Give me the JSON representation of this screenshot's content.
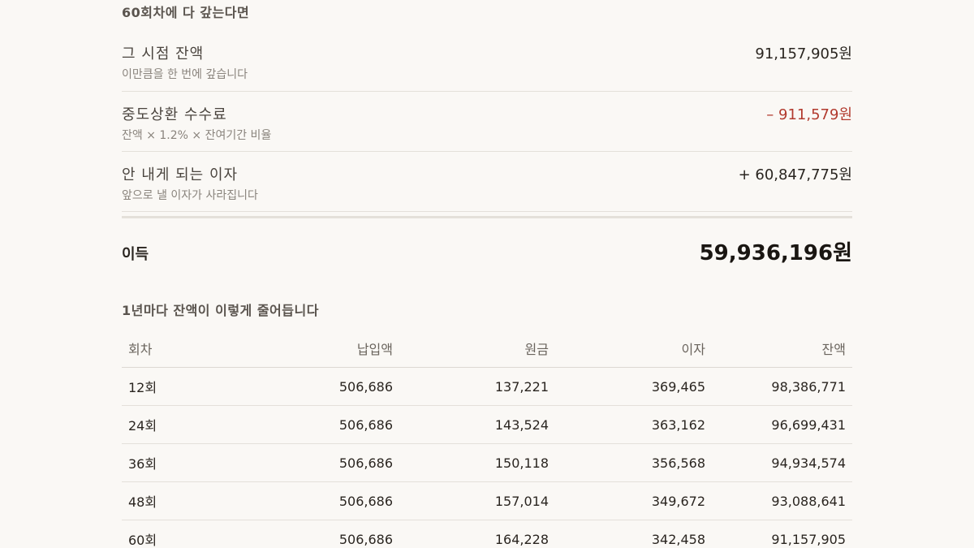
{
  "summary": {
    "title": "60회차에 다 갚는다면",
    "rows": [
      {
        "label": "그 시점 잔액",
        "sub": "이만큼을 한 번에 갚습니다",
        "amount": "91,157,905원"
      },
      {
        "label": "중도상환 수수료",
        "sub": "잔액 × 1.2% × 잔여기간 비율",
        "amount": "– 911,579원"
      },
      {
        "label": "안 내게 되는 이자",
        "sub": "앞으로 낼 이자가 사라집니다",
        "amount": "+ 60,847,775원"
      }
    ],
    "profit_label": "이득",
    "profit_amount": "59,936,196원"
  },
  "schedule": {
    "title": "1년마다 잔액이 이렇게 줄어듭니다",
    "headers": [
      "회차",
      "납입액",
      "원금",
      "이자",
      "잔액"
    ],
    "rows": [
      [
        "12회",
        "506,686",
        "137,221",
        "369,465",
        "98,386,771"
      ],
      [
        "24회",
        "506,686",
        "143,524",
        "363,162",
        "96,699,431"
      ],
      [
        "36회",
        "506,686",
        "150,118",
        "356,568",
        "94,934,574"
      ],
      [
        "48회",
        "506,686",
        "157,014",
        "349,672",
        "93,088,641"
      ],
      [
        "60회",
        "506,686",
        "164,228",
        "342,458",
        "91,157,905"
      ]
    ]
  },
  "colors": {
    "background": "#faf8f5",
    "negative": "#b23a2e",
    "text": "#2a2520"
  }
}
